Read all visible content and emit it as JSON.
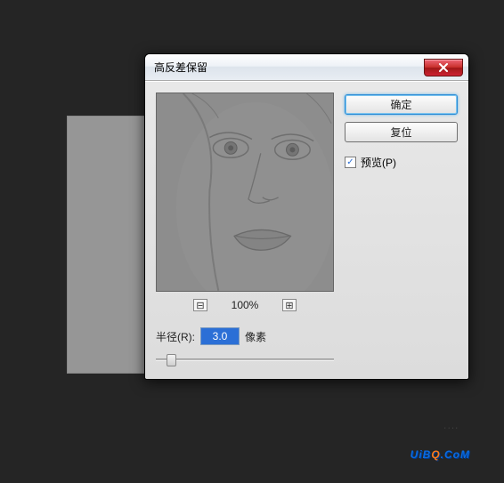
{
  "dialog": {
    "title": "高反差保留",
    "zoom": {
      "minus": "⊟",
      "plus": "⊞",
      "percent": "100%"
    },
    "radius": {
      "label": "半径(R):",
      "value": "3.0",
      "unit": "像素"
    }
  },
  "buttons": {
    "ok": "确定",
    "reset": "复位"
  },
  "preview_cb": {
    "checked": "✓",
    "label": "预览(P)"
  },
  "watermark": {
    "a": "UiB",
    "q": "Q",
    "b": ".CoM"
  },
  "tiny": "····"
}
